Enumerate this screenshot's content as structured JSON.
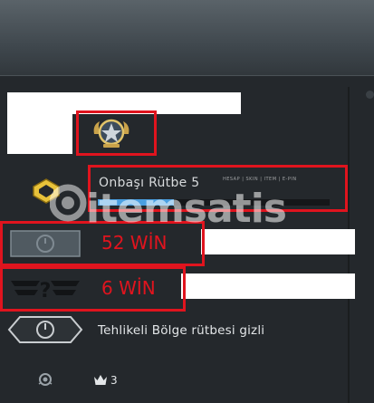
{
  "rank": {
    "label": "Onbaşı Rütbe 5",
    "progress": 0.33
  },
  "wins": {
    "row1": "52 WİN",
    "row2": "6 WİN"
  },
  "danger_zone": {
    "text": "Tehlikeli Bölge rütbesi gizli"
  },
  "crowns": {
    "count": "3"
  },
  "watermark": {
    "text": "itemsatis",
    "tag": "HESAP | SKIN | ITEM | E-PIN"
  },
  "colors": {
    "panel": "#24282c",
    "highlight": "#e0141e",
    "progress": "#4a9fe0",
    "text": "#e3e6e8"
  },
  "icons": [
    "medal-icon",
    "rank-badge-icon",
    "win-row-icon",
    "wingman-icon",
    "danger-zone-icon",
    "operation-icon",
    "crown-icon"
  ]
}
